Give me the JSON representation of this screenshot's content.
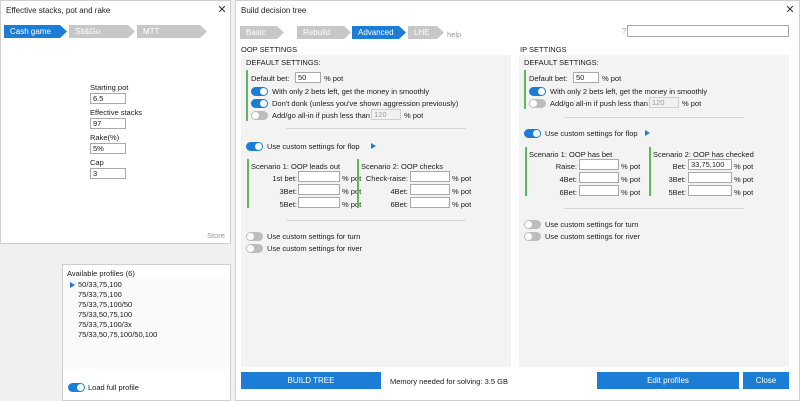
{
  "left_panel": {
    "title": "Effective stacks, pot and rake",
    "tabs": [
      {
        "label": "Cash game",
        "active": true
      },
      {
        "label": "Sit&Go",
        "active": false
      },
      {
        "label": "MTT",
        "active": false
      }
    ],
    "starting_pot_label": "Starting pot",
    "starting_pot_value": "6.5",
    "effective_stacks_label": "Effective stacks",
    "effective_stacks_value": "97",
    "rake_label": "Rake(%)",
    "rake_value": "5%",
    "cap_label": "Cap",
    "cap_value": "3",
    "store_label": "Store"
  },
  "profiles": {
    "header": "Available profiles (6)",
    "items": [
      "50/33,75,100",
      "75/33,75,100",
      "75/33,75,100/50",
      "75/33,50,75,100",
      "75/33,75,100/3x",
      "75/33,50,75,100/50,100"
    ],
    "selected_index": 0,
    "load_full_label": "Load full profile"
  },
  "tree": {
    "title": "Build decision tree",
    "tabs": [
      {
        "label": "Basic",
        "active": false
      },
      {
        "label": "Rebuild",
        "active": false
      },
      {
        "label": "Advanced",
        "active": true
      },
      {
        "label": "LHE",
        "active": false
      }
    ],
    "help_label": "help",
    "question_mark": "?",
    "search_value": "",
    "oop": {
      "heading": "OOP SETTINGS",
      "default_heading": "DEFAULT SETTINGS:",
      "default_bet_label": "Default bet:",
      "default_bet_value": "50",
      "pct_pot": "% pot",
      "two_bets_label": "With only 2 bets left, get the money in smoothly",
      "dont_donk_label": "Don't donk (unless you've shown aggression previously)",
      "allin_label": "Add/go all-in if push less than",
      "allin_value": "120",
      "flop_label": "Use custom settings for flop",
      "s1_title": "Scenario 1: OOP leads out",
      "s1_rows": [
        "1st bet:",
        "3Bet:",
        "5Bet:"
      ],
      "s2_title": "Scenario 2: OOP checks",
      "s2_rows": [
        "Check-raise:",
        "4Bet:",
        "6Bet:"
      ],
      "turn_label": "Use custom settings for turn",
      "river_label": "Use custom settings for river"
    },
    "ip": {
      "heading": "IP SETTINGS",
      "default_heading": "DEFAULT SETTINGS:",
      "default_bet_label": "Default bet:",
      "default_bet_value": "50",
      "pct_pot": "% pot",
      "two_bets_label": "With only 2 bets left, get the money in smoothly",
      "allin_label": "Add/go all-in if push less than",
      "allin_value": "120",
      "flop_label": "Use custom settings for flop",
      "s1_title": "Scenario 1: OOP has bet",
      "s1_rows": [
        "Raise:",
        "4Bet:",
        "6Bet:"
      ],
      "s2_title": "Scenario 2: OOP has checked",
      "s2_rows": [
        "Bet:",
        "3Bet:",
        "5Bet:"
      ],
      "s2_bet_value": "33,75,100",
      "turn_label": "Use custom settings for turn",
      "river_label": "Use custom settings for river"
    },
    "build_label": "BUILD TREE",
    "memory_label": "Memory needed for solving: 3.5 GB",
    "edit_profiles_label": "Edit profiles",
    "close_label": "Close"
  }
}
